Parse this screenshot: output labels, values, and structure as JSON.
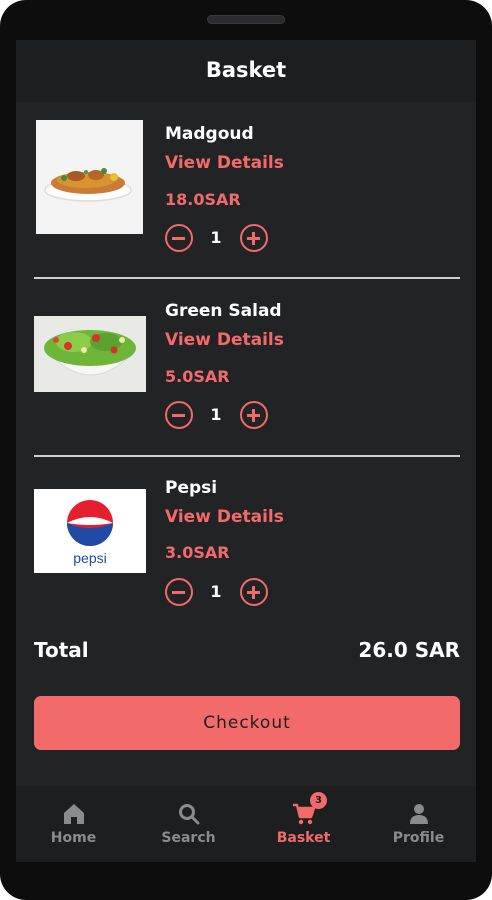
{
  "header": {
    "title": "Basket"
  },
  "items": [
    {
      "name": "Madgoud",
      "details_label": "View Details",
      "price": "18.0SAR",
      "qty": "1"
    },
    {
      "name": "Green Salad",
      "details_label": "View Details",
      "price": "5.0SAR",
      "qty": "1"
    },
    {
      "name": "Pepsi",
      "details_label": "View Details",
      "price": "3.0SAR",
      "qty": "1"
    }
  ],
  "total": {
    "label": "Total",
    "value": "26.0 SAR"
  },
  "checkout_label": "Checkout",
  "nav": {
    "items": [
      {
        "label": "Home",
        "icon": "home-icon"
      },
      {
        "label": "Search",
        "icon": "search-icon"
      },
      {
        "label": "Basket",
        "icon": "cart-icon",
        "badge": "3"
      },
      {
        "label": "Profile",
        "icon": "profile-icon"
      }
    ],
    "active": "Basket"
  },
  "pepsi_logo_text": "pepsi",
  "colors": {
    "accent": "#f26a6a",
    "background": "#222325",
    "bar": "#1d1e20",
    "muted": "#8b8b8e"
  }
}
